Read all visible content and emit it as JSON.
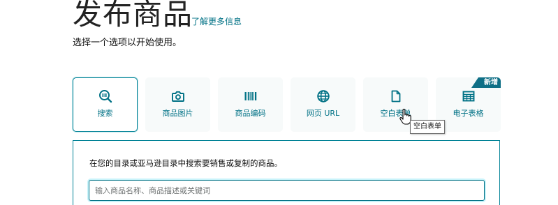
{
  "header": {
    "title": "发布商品",
    "learn_more": "了解更多信息",
    "subtitle": "选择一个选项以开始使用。"
  },
  "options": [
    {
      "label": "搜索",
      "icon": "magnifier-barcode-icon",
      "selected": true
    },
    {
      "label": "商品图片",
      "icon": "camera-icon",
      "selected": false
    },
    {
      "label": "商品编码",
      "icon": "barcode-icon",
      "selected": false
    },
    {
      "label": "网页 URL",
      "icon": "globe-icon",
      "selected": false
    },
    {
      "label": "空白表单",
      "icon": "document-icon",
      "selected": false
    },
    {
      "label": "电子表格",
      "icon": "spreadsheet-icon",
      "selected": false,
      "badge": "新增"
    }
  ],
  "tooltip": {
    "text": "空白表单"
  },
  "search_panel": {
    "description": "在您的目录或亚马逊目录中搜索要销售或复制的商品。",
    "placeholder": "输入商品名称、商品描述或关键词",
    "value": ""
  },
  "colors": {
    "accent": "#007185",
    "tile_background": "#f7fafa",
    "badge": "#0f6f86"
  }
}
